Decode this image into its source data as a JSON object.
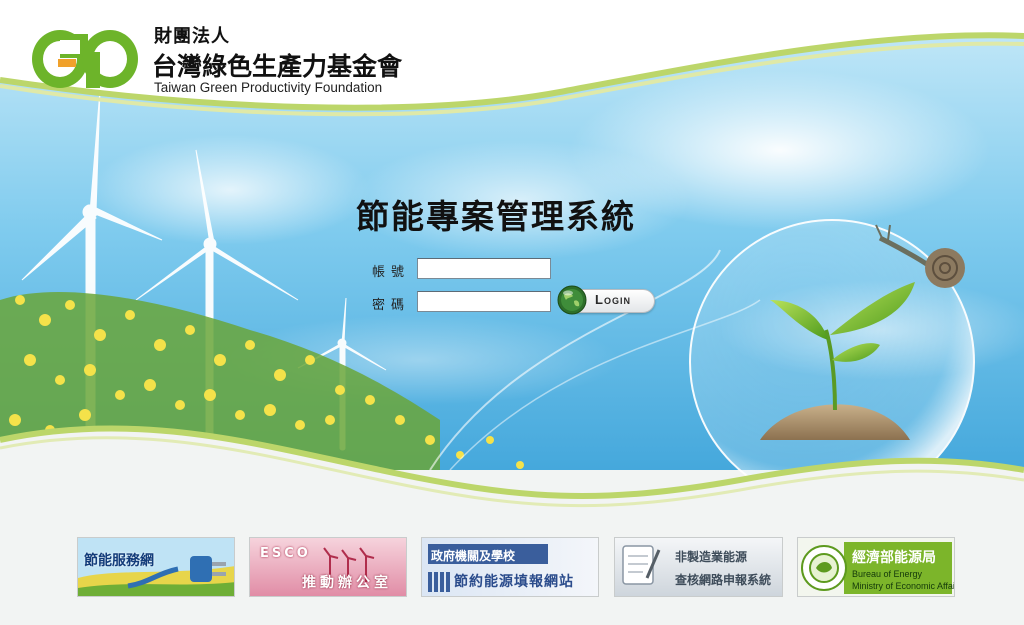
{
  "org": {
    "name_line1": "財團法人",
    "name_line2": "台灣綠色生產力基金會",
    "name_en": "Taiwan Green Productivity Foundation"
  },
  "system_title": "節能專案管理系統",
  "login_form": {
    "username_label": "帳號",
    "username_value": "",
    "password_label": "密碼",
    "password_value": "",
    "login_button_label": "Login"
  },
  "banners": [
    {
      "text": "節能服務網",
      "icon": "plug-icon"
    },
    {
      "text_line1": "ESCO",
      "text_line2": "推動辦公室",
      "icon": "wind-turbine-icon"
    },
    {
      "text_line1": "政府機關及學校",
      "text_line2": "節約能源填報網站",
      "icon": "building-icon"
    },
    {
      "text_line1": "非製造業能源",
      "text_line2": "查核網路申報系統",
      "icon": "clipboard-icon"
    },
    {
      "text": "經濟部能源局",
      "text_en_line1": "Bureau of Energy",
      "text_en_line2": "Ministry of Economic Affairs",
      "icon": "bureau-emblem-icon"
    }
  ],
  "colors": {
    "brand_green": "#7cb52a",
    "sky_blue": "#5bbbe8",
    "banner_esco_red": "#c8385a",
    "banner_gov_blue": "#3a5e9c"
  }
}
